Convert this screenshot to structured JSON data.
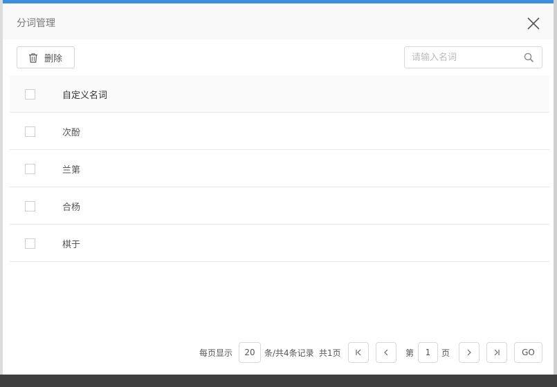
{
  "modal": {
    "title": "分词管理"
  },
  "toolbar": {
    "delete_label": "删除",
    "search_placeholder": "请输入名词",
    "search_value": ""
  },
  "table": {
    "header": "自定义名词",
    "rows": [
      "次酚",
      "兰第",
      "合杨",
      "棋于"
    ]
  },
  "pagination": {
    "per_page_label": "每页显示",
    "per_page_value": "20",
    "records_label": "条/共4条记录",
    "total_pages_label": "共1页",
    "page_prefix": "第",
    "current_page": "1",
    "page_suffix": "页",
    "go_label": "GO"
  },
  "colors": {
    "accent": "#3b8fe0",
    "header_bg": "#f9f9f9",
    "border": "#d8d8d8"
  },
  "icons": {
    "close": "close-icon",
    "delete": "trash-icon",
    "search": "search-icon",
    "first": "first-page-icon",
    "prev": "chevron-left-icon",
    "next": "chevron-right-icon",
    "last": "last-page-icon"
  }
}
